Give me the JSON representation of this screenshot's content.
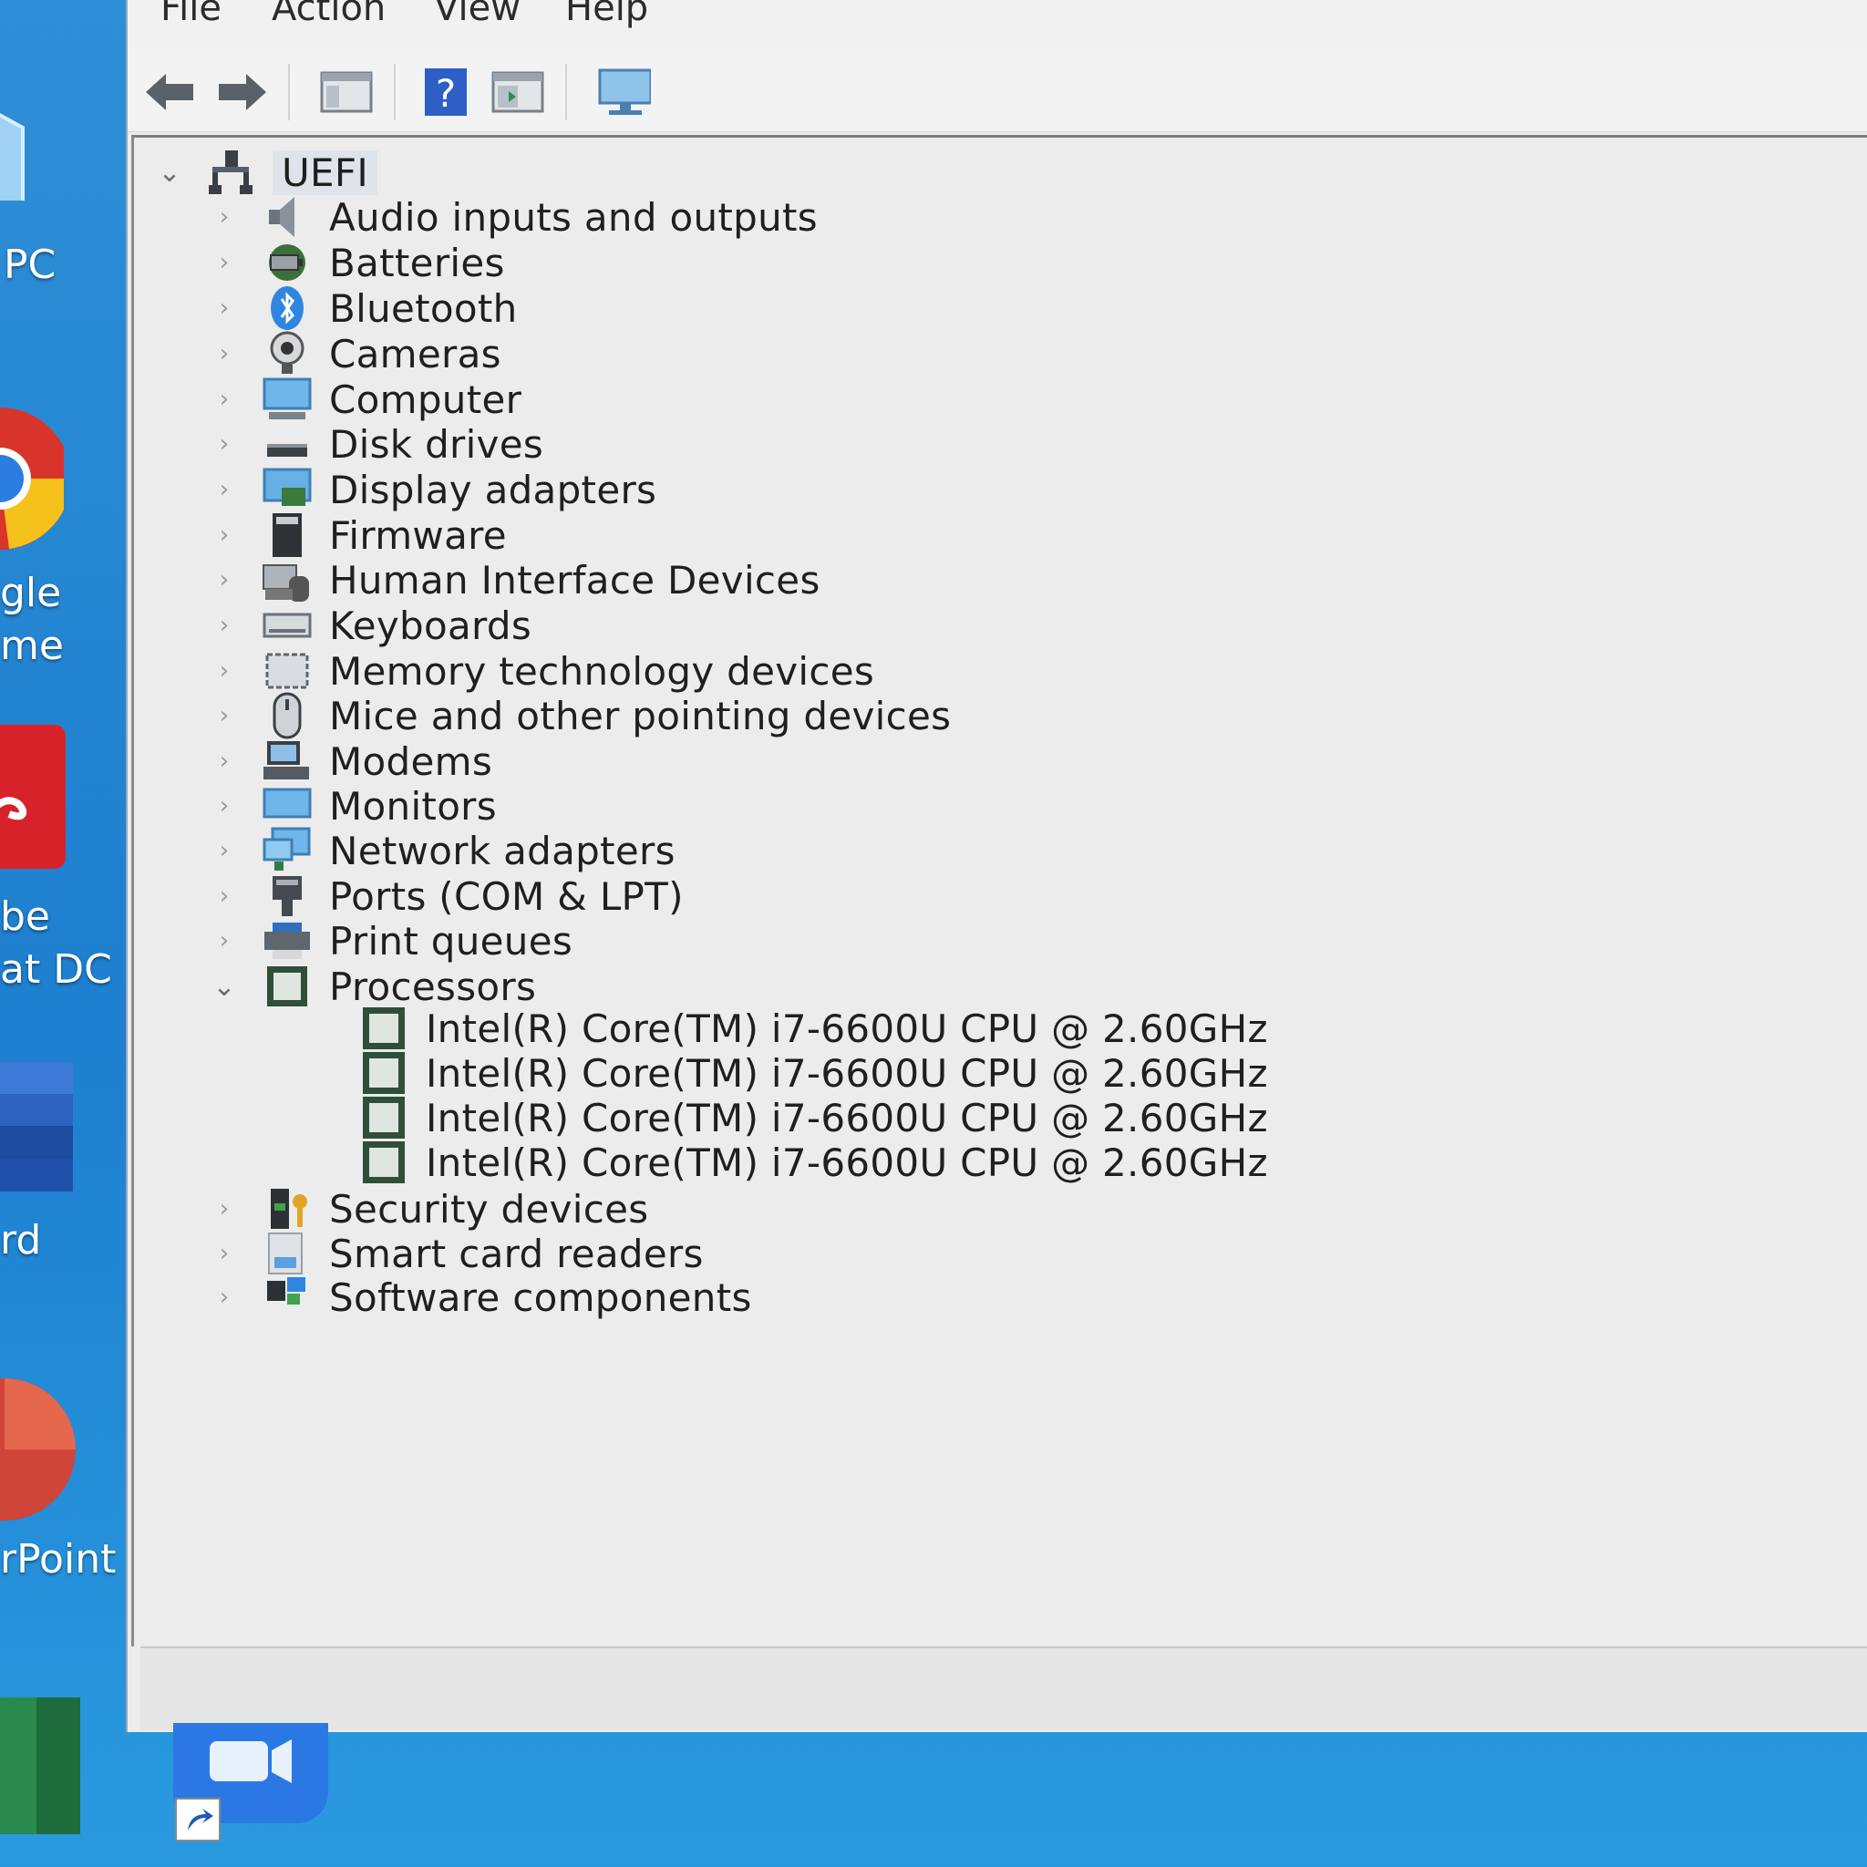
{
  "desktop": {
    "labels": [
      "PC",
      "gle",
      "me",
      "be",
      "at DC",
      "rd",
      "rPoint"
    ]
  },
  "menu": {
    "file": "File",
    "action": "Action",
    "view": "View",
    "help": "Help"
  },
  "toolbar": {
    "buttons": [
      "back-arrow-icon",
      "forward-arrow-icon",
      "show-hide-console-tree-icon",
      "help-icon",
      "properties-pane-icon",
      "monitor-icon"
    ]
  },
  "tree": {
    "root": "UEFI",
    "categories": [
      {
        "label": "Audio inputs and outputs",
        "icon": "speaker-icon"
      },
      {
        "label": "Batteries",
        "icon": "battery-icon"
      },
      {
        "label": "Bluetooth",
        "icon": "bluetooth-icon"
      },
      {
        "label": "Cameras",
        "icon": "camera-icon"
      },
      {
        "label": "Computer",
        "icon": "computer-icon"
      },
      {
        "label": "Disk drives",
        "icon": "disk-drive-icon"
      },
      {
        "label": "Display adapters",
        "icon": "display-adapter-icon"
      },
      {
        "label": "Firmware",
        "icon": "firmware-icon"
      },
      {
        "label": "Human Interface Devices",
        "icon": "hid-icon"
      },
      {
        "label": "Keyboards",
        "icon": "keyboard-icon"
      },
      {
        "label": "Memory technology devices",
        "icon": "memory-icon"
      },
      {
        "label": "Mice and other pointing devices",
        "icon": "mouse-icon"
      },
      {
        "label": "Modems",
        "icon": "modem-icon"
      },
      {
        "label": "Monitors",
        "icon": "monitor-icon"
      },
      {
        "label": "Network adapters",
        "icon": "network-adapter-icon"
      },
      {
        "label": "Ports (COM & LPT)",
        "icon": "port-icon"
      },
      {
        "label": "Print queues",
        "icon": "printer-icon"
      },
      {
        "label": "Processors",
        "icon": "processor-icon",
        "expanded": true
      },
      {
        "label": "Intel(R) Core(TM) i7-6600U CPU @ 2.60GHz",
        "icon": "processor-chip-icon",
        "child": true
      },
      {
        "label": "Intel(R) Core(TM) i7-6600U CPU @ 2.60GHz",
        "icon": "processor-chip-icon",
        "child": true
      },
      {
        "label": "Intel(R) Core(TM) i7-6600U CPU @ 2.60GHz",
        "icon": "processor-chip-icon",
        "child": true
      },
      {
        "label": "Intel(R) Core(TM) i7-6600U CPU @ 2.60GHz",
        "icon": "processor-chip-icon",
        "child": true
      },
      {
        "label": "Security devices",
        "icon": "security-icon"
      },
      {
        "label": "Smart card readers",
        "icon": "smart-card-icon"
      },
      {
        "label": "Software components",
        "icon": "software-component-icon"
      }
    ]
  },
  "colors": {
    "desktop": "#1f86d3",
    "window_bg": "#ececec",
    "chip": "#2f4f3a",
    "accent": "#3b8fe0"
  }
}
